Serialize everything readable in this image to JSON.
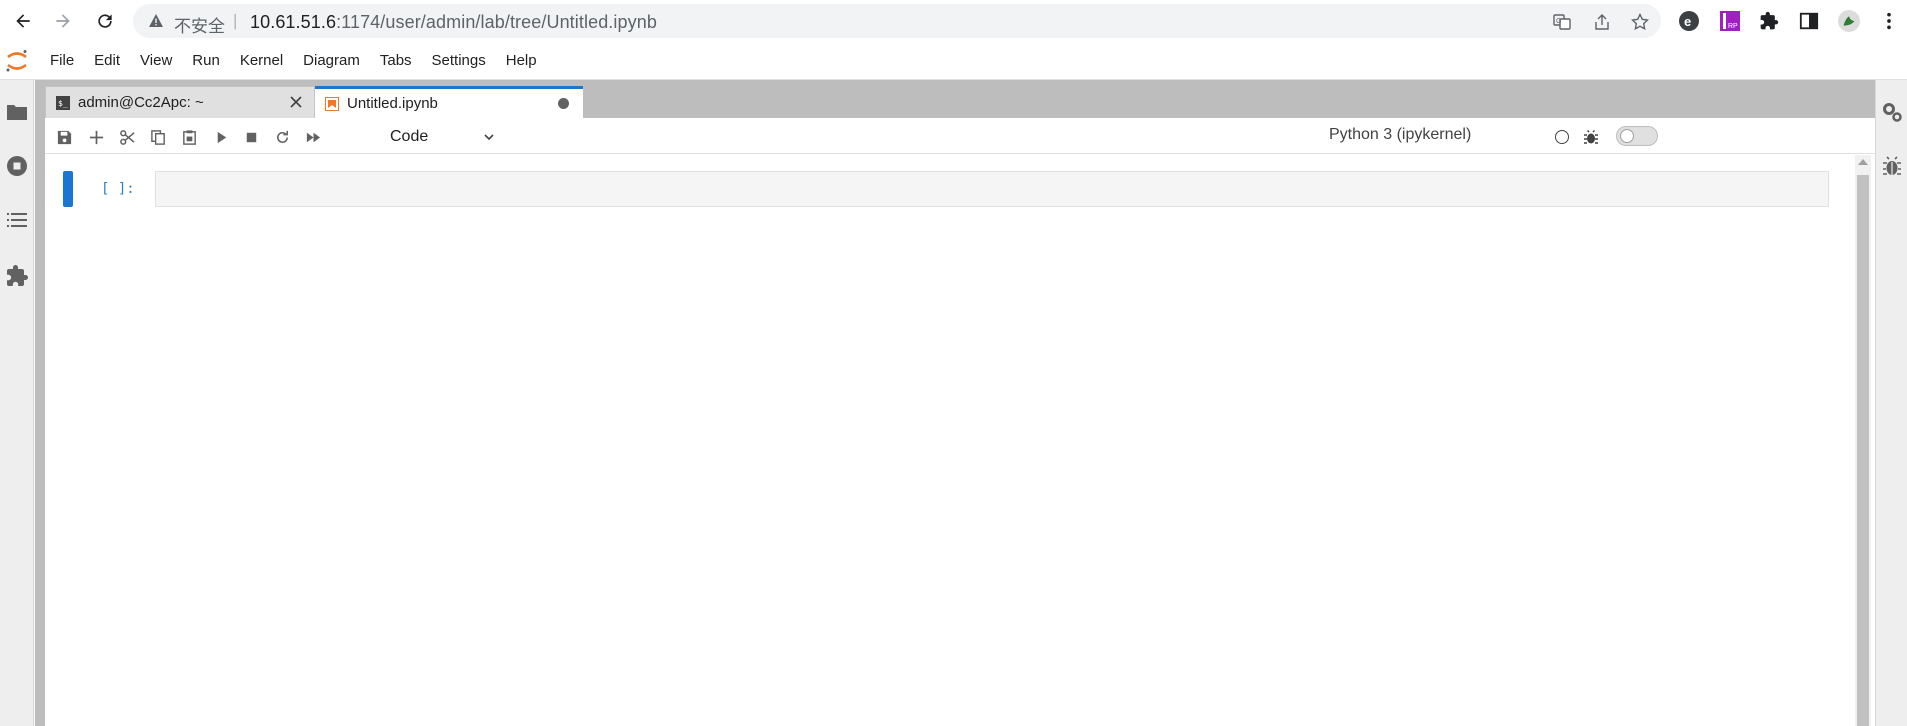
{
  "browser": {
    "insecure_label": "不安全",
    "separator": "|",
    "url_host": "10.61.51.6",
    "url_path": ":1174/user/admin/lab/tree/Untitled.ipynb"
  },
  "menubar": {
    "items": [
      "File",
      "Edit",
      "View",
      "Run",
      "Kernel",
      "Diagram",
      "Tabs",
      "Settings",
      "Help"
    ]
  },
  "tabs": [
    {
      "label": "admin@Cc2Apc: ~",
      "active": false
    },
    {
      "label": "Untitled.ipynb",
      "active": true
    }
  ],
  "toolbar": {
    "cell_type": "Code",
    "kernel_name": "Python 3 (ipykernel)"
  },
  "cell": {
    "prompt": "[ ]:",
    "content": ""
  },
  "colors": {
    "accent": "#1976d2",
    "prompt": "#307fc1",
    "jupyter_orange": "#f37726"
  }
}
